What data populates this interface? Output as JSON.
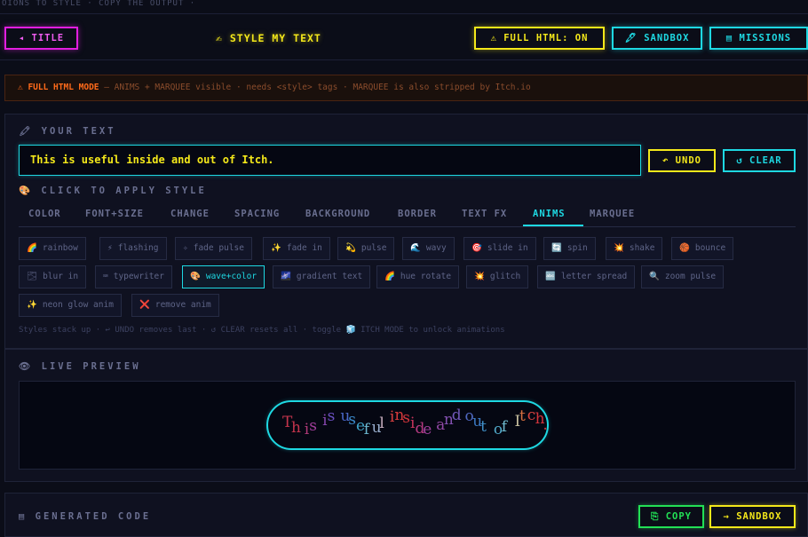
{
  "top_strip": "OIONS TO STYLE · COPY THE OUTPUT ·",
  "header": {
    "title_button": "◂ TITLE",
    "page_title": "✍ STYLE MY TEXT",
    "full_html_button": "⚠ FULL HTML: ON",
    "sandbox_button": "🖋 SANDBOX",
    "missions_button": "▤ MISSIONS"
  },
  "banner": {
    "warn": "⚠ FULL HTML MODE",
    "rest": " — ANIMS + MARQUEE visible · needs <style> tags · MARQUEE is also stripped by Itch.io"
  },
  "your_text": {
    "label": "🖍 YOUR TEXT",
    "value": "This is useful inside and out of Itch.",
    "undo": "↶ UNDO",
    "clear": "↺ CLEAR"
  },
  "apply_style": {
    "label": "🎨 CLICK TO APPLY STYLE",
    "tabs": [
      "COLOR",
      "FONT+SIZE",
      "CHANGE",
      "SPACING",
      "BACKGROUND",
      "BORDER",
      "TEXT FX",
      "ANIMS",
      "MARQUEE"
    ],
    "active_tab": "ANIMS",
    "chips": [
      {
        "icon": "🌈",
        "label": "rainbow"
      },
      {
        "icon": "⚡",
        "label": "flashing"
      },
      {
        "icon": "✧",
        "label": "fade pulse"
      },
      {
        "icon": "✨",
        "label": "fade in"
      },
      {
        "icon": "💫",
        "label": "pulse"
      },
      {
        "icon": "🌊",
        "label": "wavy"
      },
      {
        "icon": "🎯",
        "label": "slide in"
      },
      {
        "icon": "🔄",
        "label": "spin"
      },
      {
        "icon": "💥",
        "label": "shake"
      },
      {
        "icon": "🏀",
        "label": "bounce"
      },
      {
        "icon": "🌫",
        "label": "blur in"
      },
      {
        "icon": "⌨",
        "label": "typewriter"
      },
      {
        "icon": "🎨",
        "label": "wave+color"
      },
      {
        "icon": "🌌",
        "label": "gradient text"
      },
      {
        "icon": "🌈",
        "label": "hue rotate"
      },
      {
        "icon": "💥",
        "label": "glitch"
      },
      {
        "icon": "🔤",
        "label": "letter spread"
      },
      {
        "icon": "🔍",
        "label": "zoom pulse"
      },
      {
        "icon": "✨",
        "label": "neon glow anim"
      },
      {
        "icon": "❌",
        "label": "remove anim"
      }
    ],
    "hint": "Styles stack up · ↩ UNDO removes last · ↺ CLEAR resets all · toggle 🧊 ITCH MODE to unlock animations"
  },
  "preview": {
    "label": "👁 LIVE PREVIEW",
    "letters": [
      {
        "ch": "T",
        "color": "#c4344c"
      },
      {
        "ch": "h",
        "color": "#c4344c"
      },
      {
        "ch": "i",
        "color": "#b03a78"
      },
      {
        "ch": "s",
        "color": "#a23e9c"
      },
      {
        "ch": "i",
        "color": "#8848b0"
      },
      {
        "ch": "s",
        "color": "#6a50c0"
      },
      {
        "ch": "u",
        "color": "#4a68c8"
      },
      {
        "ch": "s",
        "color": "#3a88c8"
      },
      {
        "ch": "e",
        "color": "#40a4c8"
      },
      {
        "ch": "f",
        "color": "#6cb8d0"
      },
      {
        "ch": "u",
        "color": "#9ab0d0"
      },
      {
        "ch": "l",
        "color": "#c8b0c0"
      },
      {
        "ch": "i",
        "color": "#d84040"
      },
      {
        "ch": "n",
        "color": "#d83a3a"
      },
      {
        "ch": "s",
        "color": "#d0343a"
      },
      {
        "ch": "i",
        "color": "#c8345c"
      },
      {
        "ch": "d",
        "color": "#b43a80"
      },
      {
        "ch": "e",
        "color": "#a0409c"
      },
      {
        "ch": "a",
        "color": "#9248a4"
      },
      {
        "ch": "n",
        "color": "#8250b0"
      },
      {
        "ch": "d",
        "color": "#7058b8"
      },
      {
        "ch": "o",
        "color": "#5068c0"
      },
      {
        "ch": "u",
        "color": "#3c7ac4"
      },
      {
        "ch": "t",
        "color": "#4090c8"
      },
      {
        "ch": "o",
        "color": "#50a8c8"
      },
      {
        "ch": "f",
        "color": "#70bcd0"
      },
      {
        "ch": "I",
        "color": "#c8c0a0"
      },
      {
        "ch": "t",
        "color": "#d87040"
      },
      {
        "ch": "c",
        "color": "#d84440"
      },
      {
        "ch": "h",
        "color": "#d4343c"
      },
      {
        "ch": ".",
        "color": "#d0343c"
      }
    ]
  },
  "generated_code": {
    "label": "▤ GENERATED CODE",
    "copy": "⎘ COPY",
    "sandbox": "→ SANDBOX"
  }
}
